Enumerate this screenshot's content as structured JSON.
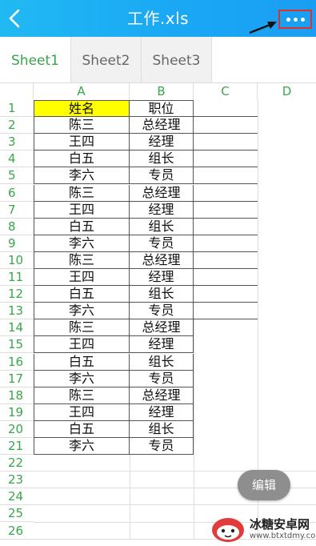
{
  "header": {
    "title": "工作.xls",
    "colors": {
      "bar": "#1aa8f4",
      "highlight_box": "#e0312d"
    }
  },
  "tabs": [
    {
      "label": "Sheet1",
      "active": true
    },
    {
      "label": "Sheet2",
      "active": false
    },
    {
      "label": "Sheet3",
      "active": false
    }
  ],
  "columns": [
    "A",
    "B",
    "C",
    "D"
  ],
  "row_numbers": [
    "1",
    "2",
    "3",
    "4",
    "5",
    "6",
    "7",
    "8",
    "9",
    "10",
    "11",
    "12",
    "13",
    "14",
    "15",
    "16",
    "17",
    "18",
    "19",
    "20",
    "21",
    "22",
    "23",
    "24",
    "25",
    "26"
  ],
  "rows": [
    [
      "姓名",
      "职位"
    ],
    [
      "陈三",
      "总经理"
    ],
    [
      "王四",
      "经理"
    ],
    [
      "白五",
      "组长"
    ],
    [
      "李六",
      "专员"
    ],
    [
      "陈三",
      "总经理"
    ],
    [
      "王四",
      "经理"
    ],
    [
      "白五",
      "组长"
    ],
    [
      "李六",
      "专员"
    ],
    [
      "陈三",
      "总经理"
    ],
    [
      "王四",
      "经理"
    ],
    [
      "白五",
      "组长"
    ],
    [
      "李六",
      "专员"
    ],
    [
      "陈三",
      "总经理"
    ],
    [
      "王四",
      "经理"
    ],
    [
      "白五",
      "组长"
    ],
    [
      "李六",
      "专员"
    ],
    [
      "陈三",
      "总经理"
    ],
    [
      "王四",
      "经理"
    ],
    [
      "白五",
      "组长"
    ],
    [
      "李六",
      "专员"
    ]
  ],
  "header_cell_fill": "#ffff00",
  "edit_button": {
    "label": "编辑"
  },
  "watermark": {
    "line1": "冰糖安卓网",
    "line2": "www.btxtdmy.com"
  },
  "icons": {
    "back": "chevron-left-icon",
    "more": "more-dots-icon",
    "annotation": "arrow-annotation-icon"
  }
}
